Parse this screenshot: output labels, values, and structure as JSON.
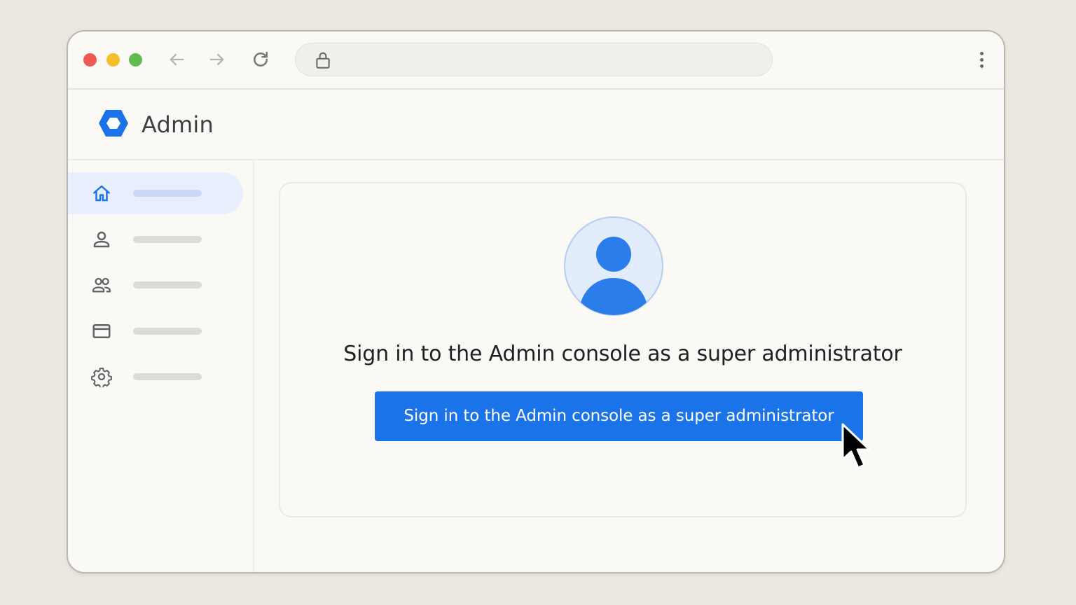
{
  "browser": {
    "address": "",
    "icons": {
      "back": "arrow-left-icon",
      "forward": "arrow-right-icon",
      "reload": "reload-icon",
      "lock": "lock-icon",
      "menu": "more-vert-icon"
    }
  },
  "app": {
    "title": "Admin",
    "logo": "admin-hexagon-logo",
    "brand_color": "#1a73e8"
  },
  "sidebar": {
    "items": [
      {
        "icon": "home-icon",
        "active": true
      },
      {
        "icon": "user-icon",
        "active": false
      },
      {
        "icon": "group-icon",
        "active": false
      },
      {
        "icon": "billing-card-icon",
        "active": false
      },
      {
        "icon": "gear-icon",
        "active": false
      }
    ]
  },
  "main": {
    "heading": "Sign in to the Admin console as a super administrator",
    "button_label": "Sign in to the Admin console as a super administrator",
    "avatar": "account-avatar-icon"
  }
}
